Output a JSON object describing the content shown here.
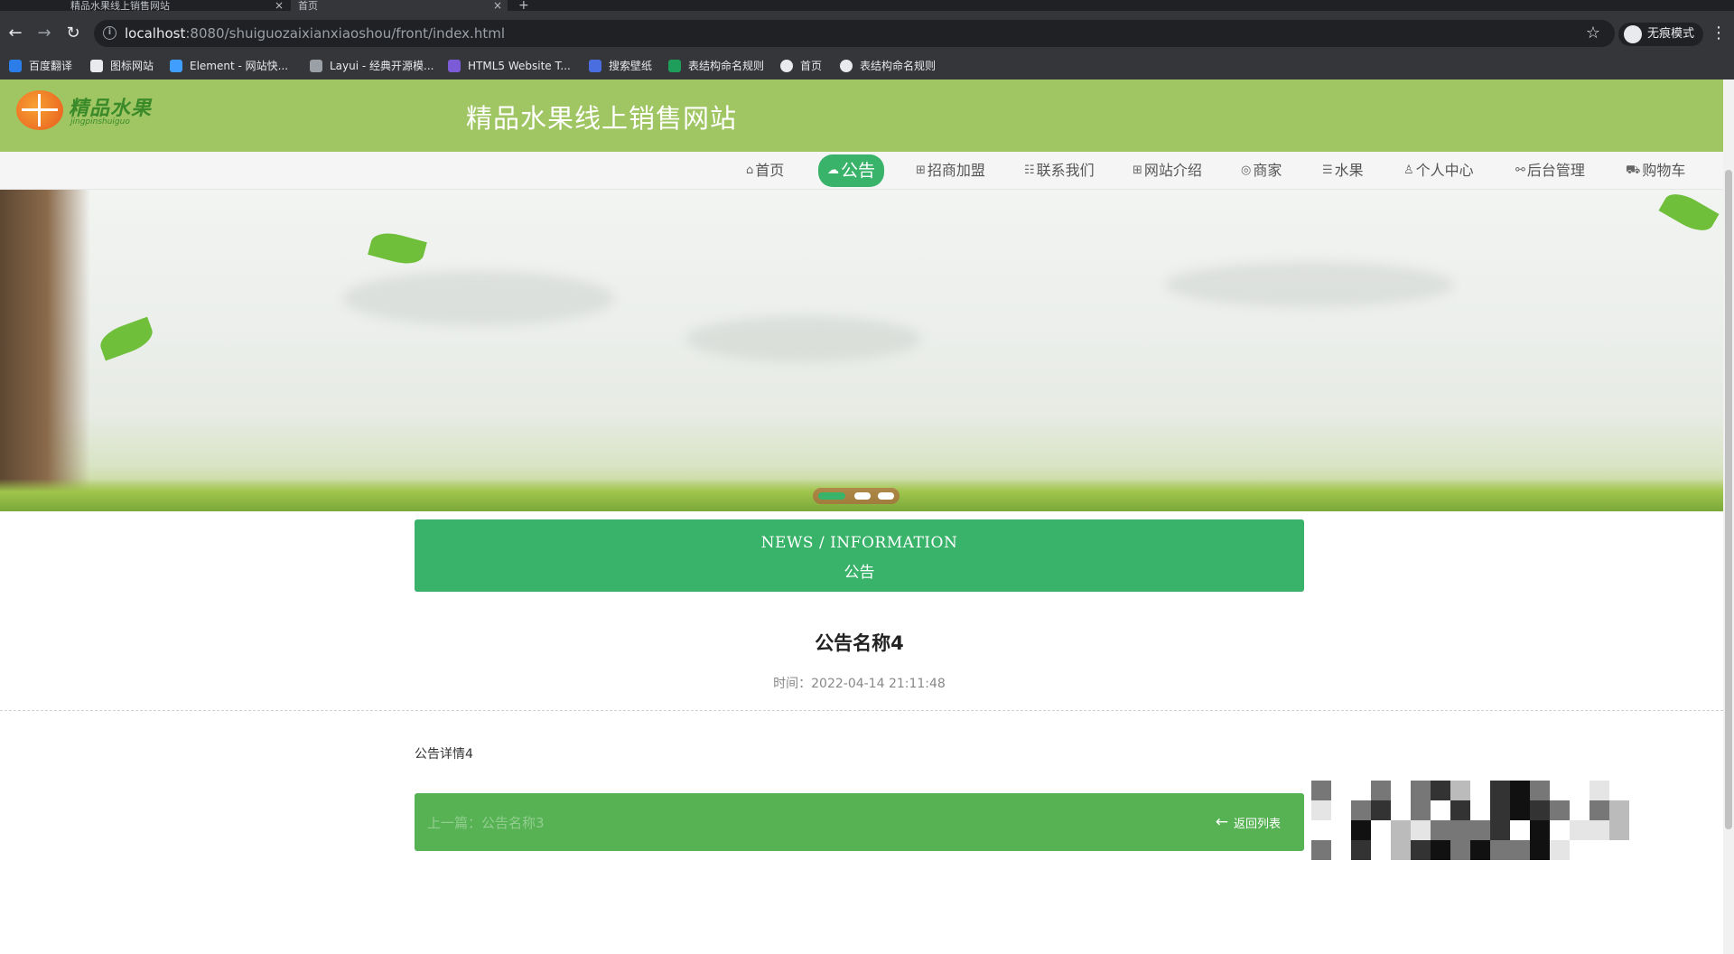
{
  "browser": {
    "tabs": [
      {
        "title": "精品水果线上销售网站",
        "active": false
      },
      {
        "title": "首页",
        "active": true
      }
    ],
    "url_host": "localhost",
    "url_path": ":8080/shuiguozaixianxiaoshou/front/index.html",
    "incognito_label": "无痕模式",
    "bookmarks": [
      "百度翻译",
      "图标网站",
      "Element - 网站快...",
      "Layui - 经典开源模...",
      "HTML5 Website T...",
      "搜索壁纸",
      "表结构命名规则",
      "首页",
      "表结构命名规则"
    ]
  },
  "header": {
    "logo_text": "精品水果",
    "logo_sub": "jingpinshuiguo",
    "site_title": "精品水果线上销售网站"
  },
  "nav": {
    "items": [
      {
        "label": "首页",
        "icon": "home-icon",
        "glyph": "⌂"
      },
      {
        "label": "公告",
        "icon": "notice-icon",
        "glyph": "☁",
        "active": true
      },
      {
        "label": "招商加盟",
        "icon": "grid-icon",
        "glyph": "⊞"
      },
      {
        "label": "联系我们",
        "icon": "contact-icon",
        "glyph": "☷"
      },
      {
        "label": "网站介绍",
        "icon": "apps-icon",
        "glyph": "⊞"
      },
      {
        "label": "商家",
        "icon": "shop-icon",
        "glyph": "◎"
      },
      {
        "label": "水果",
        "icon": "sliders-icon",
        "glyph": "☰"
      },
      {
        "label": "个人中心",
        "icon": "user-icon",
        "glyph": "♙"
      },
      {
        "label": "后台管理",
        "icon": "link-icon",
        "glyph": "⚯"
      },
      {
        "label": "购物车",
        "icon": "cart-icon",
        "glyph": "⛟"
      }
    ]
  },
  "news": {
    "heading_en": "NEWS / INFORMATION",
    "heading_cn": "公告"
  },
  "article": {
    "title": "公告名称4",
    "time": "时间：2022-04-14 21:11:48",
    "body": "公告详情4"
  },
  "footer": {
    "prev_next": "上一篇：公告名称3",
    "back_label": "返回列表"
  },
  "colors": {
    "header_bg": "#a0c663",
    "accent": "#3ab36a",
    "footer_bar": "#57b254"
  }
}
